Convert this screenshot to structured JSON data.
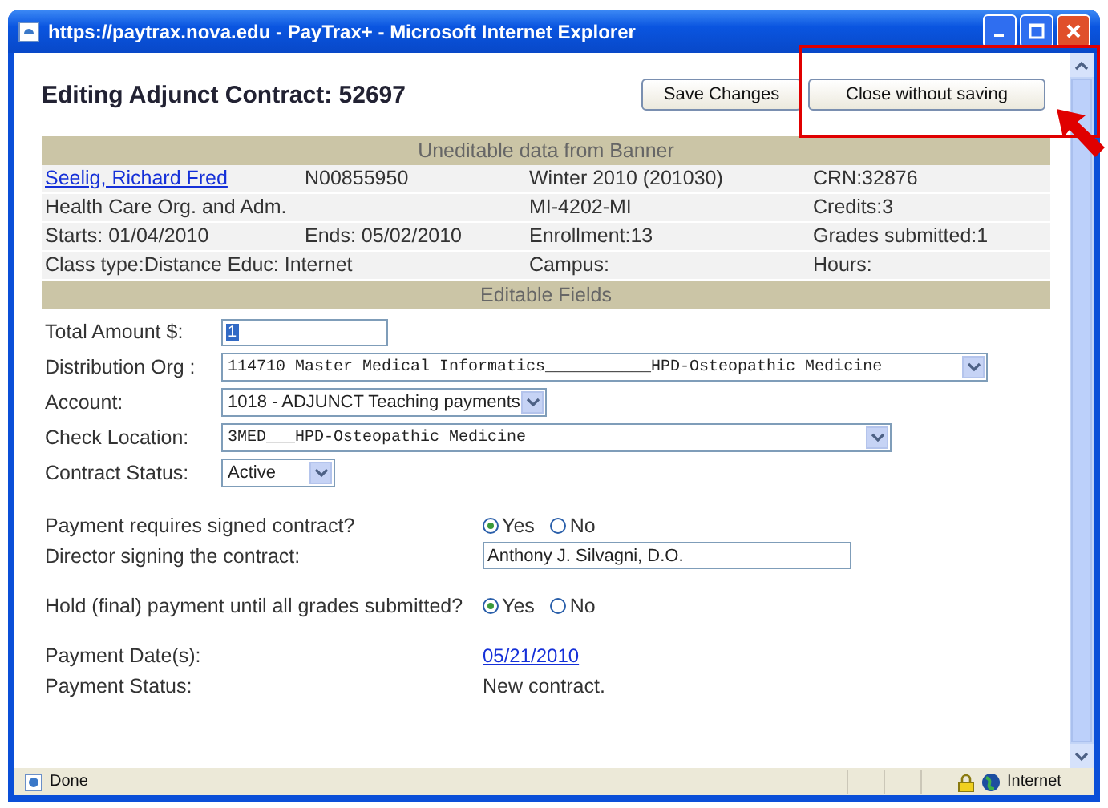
{
  "window": {
    "title": "https://paytrax.nova.edu - PayTrax+ - Microsoft Internet Explorer"
  },
  "heading": "Editing Adjunct Contract: 52697",
  "buttons": [
    {
      "label": "Save Changes"
    },
    {
      "label": "Close without saving"
    }
  ],
  "banner_header": "Uneditable data from Banner",
  "info_rows": [
    {
      "cells": [
        {
          "text": "Seelig, Richard Fred",
          "kind": "link"
        },
        {
          "text": "N00855950",
          "kind": "text"
        },
        {
          "text": "Winter 2010 (201030)",
          "kind": "text"
        },
        {
          "text": "CRN:32876",
          "kind": "text"
        }
      ]
    },
    {
      "cells": [
        {
          "text": "Health Care Org. and Adm.",
          "kind": "text"
        },
        {
          "text": "MI-4202-MI",
          "kind": "text"
        },
        {
          "text": "Credits:3",
          "kind": "text"
        }
      ]
    },
    {
      "cells": [
        {
          "text": "Starts: 01/04/2010",
          "kind": "text"
        },
        {
          "text": "Ends: 05/02/2010",
          "kind": "text"
        },
        {
          "text": "Enrollment:13",
          "kind": "text"
        },
        {
          "text": "Grades submitted:1",
          "kind": "text"
        }
      ]
    },
    {
      "cells": [
        {
          "text": "Class type:Distance Educ: Internet",
          "kind": "text"
        },
        {
          "text": "Campus:",
          "kind": "text"
        },
        {
          "text": "Hours:",
          "kind": "text"
        }
      ]
    }
  ],
  "editable_header": "Editable Fields",
  "groups": [
    {
      "kind": "narrow",
      "rows": [
        {
          "kind": "text",
          "label": "Total Amount $:",
          "value": "1"
        },
        {
          "kind": "select",
          "label": "Distribution Org :",
          "value": "114710 Master Medical Informatics___________HPD-Osteopathic Medicine",
          "mono": true
        },
        {
          "kind": "select",
          "label": "Account:",
          "value": "1018 - ADJUNCT Teaching payments",
          "mono": false
        },
        {
          "kind": "select",
          "label": "Check Location:",
          "value": "3MED___HPD-Osteopathic Medicine",
          "mono": true
        },
        {
          "kind": "select",
          "label": "Contract Status:",
          "value": "Active",
          "mono": false
        }
      ]
    },
    {
      "kind": "wide",
      "rows": [
        {
          "kind": "radio",
          "label": "Payment requires signed contract?",
          "options": [
            {
              "label": "Yes",
              "selected": true
            },
            {
              "label": "No",
              "selected": false
            }
          ]
        },
        {
          "kind": "text",
          "label": "Director signing the contract:",
          "value": "Anthony J. Silvagni, D.O."
        }
      ]
    },
    {
      "kind": "wide",
      "rows": [
        {
          "kind": "radio",
          "label": "Hold (final) payment until all grades submitted?",
          "options": [
            {
              "label": "Yes",
              "selected": true
            },
            {
              "label": "No",
              "selected": false
            }
          ]
        }
      ]
    },
    {
      "kind": "wide",
      "rows": [
        {
          "kind": "link",
          "label": "Payment Date(s):",
          "value": "05/21/2010"
        },
        {
          "kind": "plain",
          "label": "Payment Status:",
          "value": "New contract."
        }
      ]
    }
  ],
  "status_bar": {
    "text": "Done",
    "zone": "Internet"
  }
}
